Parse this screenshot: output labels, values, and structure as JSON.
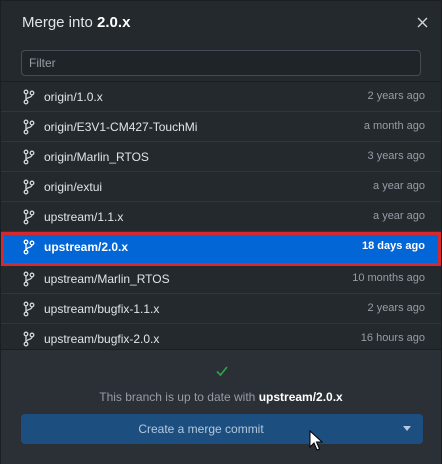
{
  "dialog": {
    "title_prefix": "Merge into",
    "title_branch": "2.0.x",
    "close_icon": "close-icon"
  },
  "filter": {
    "placeholder": "Filter",
    "value": ""
  },
  "branches": [
    {
      "name": "origin/1.0.x",
      "time": "2 years ago",
      "selected": false
    },
    {
      "name": "origin/E3V1-CM427-TouchMi",
      "time": "a month ago",
      "selected": false
    },
    {
      "name": "origin/Marlin_RTOS",
      "time": "3 years ago",
      "selected": false
    },
    {
      "name": "origin/extui",
      "time": "a year ago",
      "selected": false
    },
    {
      "name": "upstream/1.1.x",
      "time": "a year ago",
      "selected": false
    },
    {
      "name": "upstream/2.0.x",
      "time": "18 days ago",
      "selected": true
    },
    {
      "name": "upstream/Marlin_RTOS",
      "time": "10 months ago",
      "selected": false
    },
    {
      "name": "upstream/bugfix-1.1.x",
      "time": "2 years ago",
      "selected": false
    },
    {
      "name": "upstream/bugfix-2.0.x",
      "time": "16 hours ago",
      "selected": false
    }
  ],
  "footer": {
    "status_prefix": "This branch is up to date with",
    "status_branch": "upstream/2.0.x",
    "merge_button_label": "Create a merge commit"
  },
  "colors": {
    "selection": "#0366d6",
    "highlight_border": "#d7282f",
    "check": "#28a745",
    "button": "#1c4e80"
  }
}
